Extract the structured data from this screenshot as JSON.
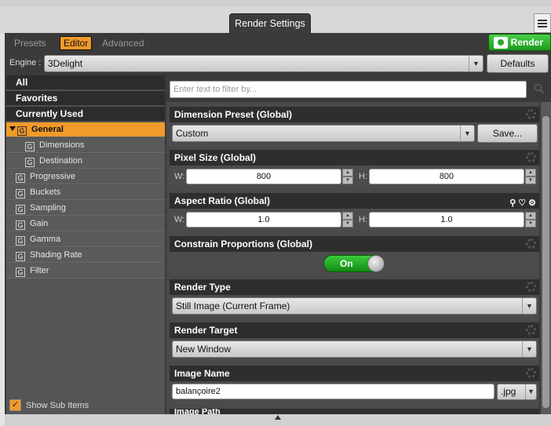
{
  "window": {
    "title": "Render Settings"
  },
  "subtabs": [
    {
      "label": "Presets"
    },
    {
      "label": "Editor"
    },
    {
      "label": "Advanced"
    }
  ],
  "render_button": {
    "label": "Render"
  },
  "engine": {
    "label": "Engine :",
    "value": "3Delight",
    "defaults_label": "Defaults"
  },
  "filter": {
    "placeholder": "Enter text to filter by..."
  },
  "nav": {
    "top_items": [
      {
        "label": "All"
      },
      {
        "label": "Favorites"
      },
      {
        "label": "Currently Used"
      }
    ],
    "tree_items": [
      {
        "label": "General"
      },
      {
        "label": "Dimensions"
      },
      {
        "label": "Destination"
      },
      {
        "label": "Progressive"
      },
      {
        "label": "Buckets"
      },
      {
        "label": "Sampling"
      },
      {
        "label": "Gain"
      },
      {
        "label": "Gamma"
      },
      {
        "label": "Shading Rate"
      },
      {
        "label": "Filter"
      }
    ],
    "group_glyph": "G",
    "show_sub_items": "Show Sub Items"
  },
  "groups": {
    "dimension_preset": {
      "title": "Dimension Preset (Global)",
      "value": "Custom",
      "save_label": "Save..."
    },
    "pixel_size": {
      "title": "Pixel Size (Global)",
      "w_label": "W:",
      "w_value": "800",
      "h_label": "H:",
      "h_value": "800"
    },
    "aspect_ratio": {
      "title": "Aspect Ratio (Global)",
      "w_label": "W:",
      "w_value": "1.0",
      "h_label": "H:",
      "h_value": "1.0"
    },
    "constrain": {
      "title": "Constrain Proportions (Global)",
      "toggle_label": "On"
    },
    "render_type": {
      "title": "Render Type",
      "value": "Still Image (Current Frame)"
    },
    "render_target": {
      "title": "Render Target",
      "value": "New Window"
    },
    "image_name": {
      "title": "Image Name",
      "value": "balançoire2",
      "ext": ".jpg"
    },
    "image_path": {
      "title": "Image Path"
    }
  },
  "colors": {
    "accent": "#f09a2a",
    "render_green": "#2aa82a"
  }
}
